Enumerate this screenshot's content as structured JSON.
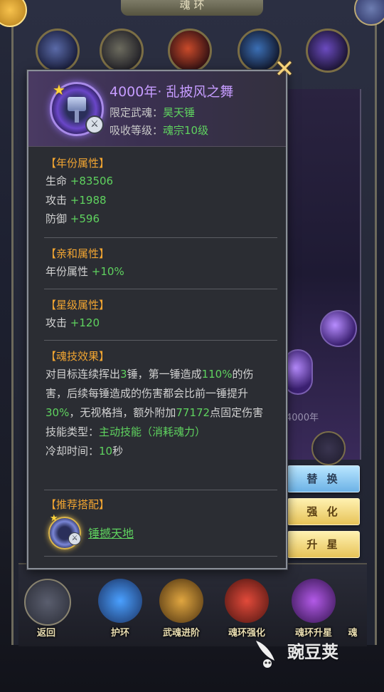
{
  "background": {
    "header_title": "魂 环",
    "record_text": "4000年",
    "bottom_tabs": [
      {
        "label": "返回"
      },
      {
        "label": "护环"
      },
      {
        "label": "武魂进阶"
      },
      {
        "label": "魂环强化"
      },
      {
        "label": "魂环升星"
      },
      {
        "label": "魂"
      }
    ]
  },
  "popup": {
    "title": "4000年· 乱披风之舞",
    "weapon_label": "限定武魂：",
    "weapon_value": "昊天锤",
    "level_label": "吸收等级：",
    "level_value": "魂宗10级",
    "year_attr": {
      "title": "【年份属性】",
      "rows": [
        {
          "label": "生命",
          "value": "+83506"
        },
        {
          "label": "攻击",
          "value": "+1988"
        },
        {
          "label": "防御",
          "value": "+596"
        }
      ]
    },
    "affinity_attr": {
      "title": "【亲和属性】",
      "rows": [
        {
          "label": "年份属性",
          "value": "+10%"
        }
      ]
    },
    "star_attr": {
      "title": "【星级属性】",
      "rows": [
        {
          "label": "攻击",
          "value": "+120"
        }
      ]
    },
    "skill": {
      "title": "【魂技效果】",
      "p1": "对目标连续挥出",
      "n1": "3",
      "p2": "锤，第一锤造成",
      "n2": "110%",
      "p3": "的伤害，后续每锤造成的伤害都会比前一锤提升",
      "n3": "30%",
      "p4": "，无视格挡，额外附加",
      "n4": "77172",
      "p5": "点固定伤害",
      "type_label": "技能类型：",
      "type_value": "主动技能（消耗魂力）",
      "cd_label": "冷却时间：",
      "cd_value": "10",
      "cd_unit": "秒"
    },
    "recommend": {
      "title": "【推荐搭配】",
      "link": "锤撼天地"
    }
  },
  "side_buttons": {
    "replace": "替 换",
    "enhance": "强 化",
    "star_up": "升 星"
  },
  "watermark": "豌豆荚",
  "colors": {
    "green_value": "#5fd35f",
    "section_title": "#f2a531",
    "ring_title": "#c69cff",
    "popup_bg": "#2b2d33"
  }
}
